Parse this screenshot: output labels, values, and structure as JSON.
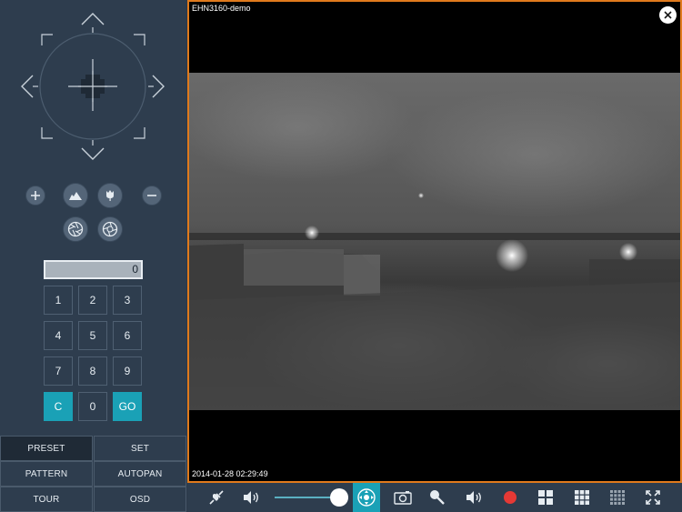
{
  "ptz": {
    "zoom_in_label": "+",
    "zoom_out_label": "−"
  },
  "preset_input": {
    "value": "0"
  },
  "keypad": {
    "keys": [
      "1",
      "2",
      "3",
      "4",
      "5",
      "6",
      "7",
      "8",
      "9",
      "C",
      "0",
      "GO"
    ]
  },
  "modes": {
    "preset": "PRESET",
    "set": "SET",
    "pattern": "PATTERN",
    "autopan": "AUTOPAN",
    "tour": "TOUR",
    "osd": "OSD",
    "active": "PRESET"
  },
  "video": {
    "camera_name": "EHN3160-demo",
    "timestamp": "2014-01-28 02:29:49"
  },
  "colors": {
    "accent": "#1aa1b6",
    "frame_border": "#e07a1c",
    "record": "#e53935",
    "panel_bg": "#2e3d4e"
  },
  "toolbar": {
    "volume_level": 0.85,
    "icons": [
      "connect-icon",
      "speaker-icon",
      "volume-slider",
      "ptz-icon",
      "snapshot-icon",
      "microphone-icon",
      "speaker-icon",
      "record-icon",
      "grid-2x2-icon",
      "grid-3x3-icon",
      "grid-4x4-icon",
      "fullscreen-icon"
    ]
  }
}
